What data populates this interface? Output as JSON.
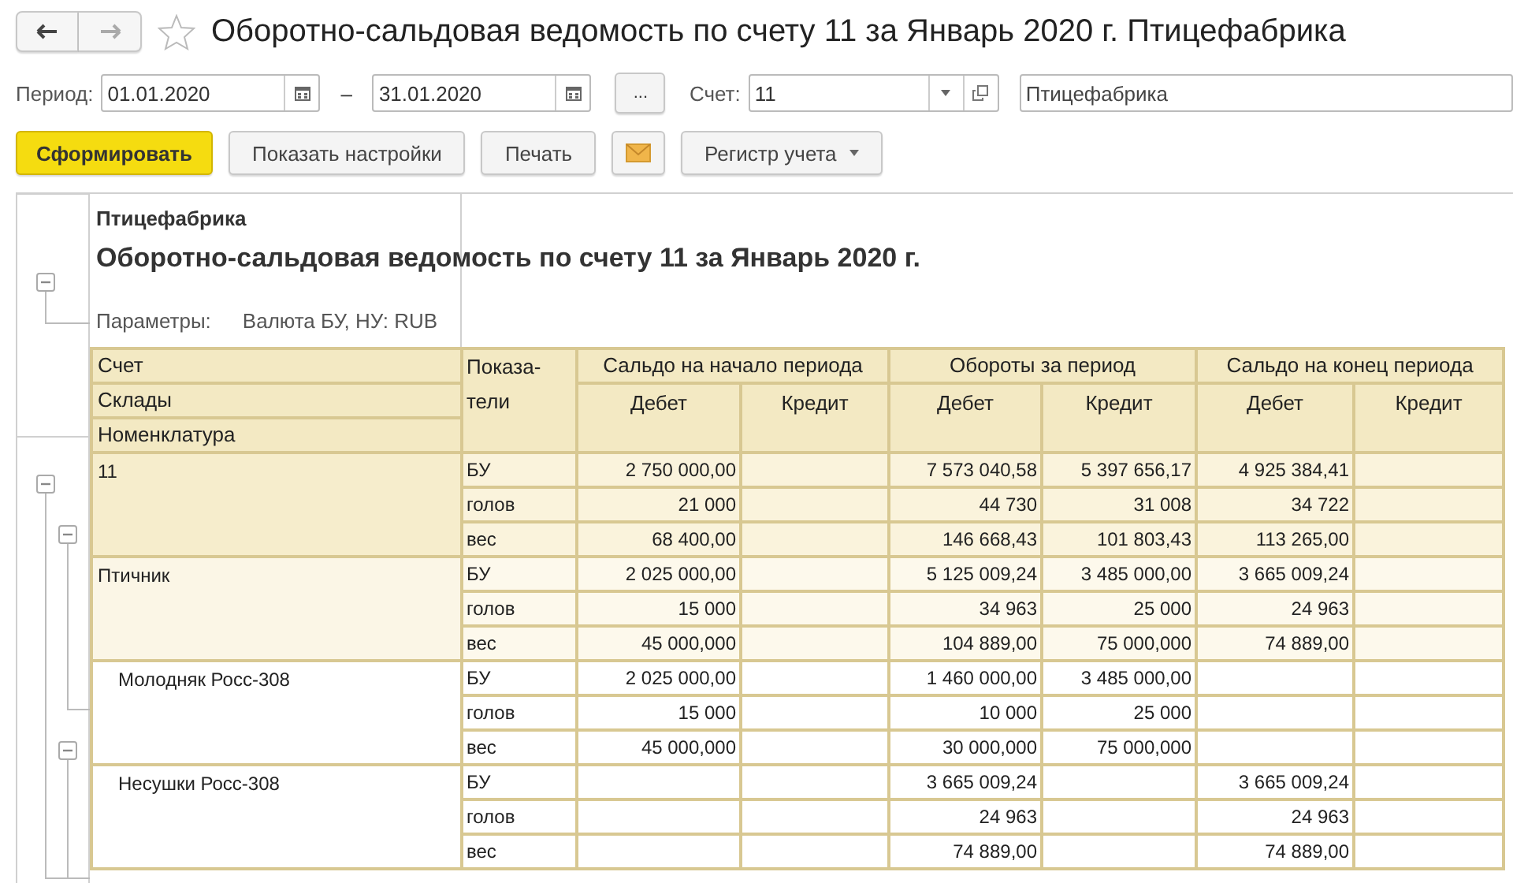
{
  "window": {
    "title": "Оборотно-сальдовая ведомость по счету 11 за Январь 2020 г. Птицефабрика"
  },
  "filters": {
    "period_label": "Период:",
    "date_from": "01.01.2020",
    "dash": "–",
    "date_to": "31.01.2020",
    "period_button": "...",
    "account_label": "Счет:",
    "account": "11",
    "organization": "Птицефабрика"
  },
  "toolbar": [
    {
      "kind": "primary",
      "label": "Сформировать"
    },
    {
      "kind": "plain",
      "label": "Показать настройки"
    },
    {
      "kind": "plain",
      "label": "Печать"
    },
    {
      "kind": "mail"
    },
    {
      "kind": "dropdown",
      "label": "Регистр учета"
    }
  ],
  "outline_toggles": [
    {
      "expanded": true
    },
    {
      "expanded": true
    },
    {
      "expanded": true
    },
    {
      "expanded": true
    }
  ],
  "report": {
    "organization": "Птицефабрика",
    "title": "Оборотно-сальдовая ведомость по счету 11 за Январь 2020 г.",
    "params_label": "Параметры:",
    "params_value": "Валюта БУ, НУ: RUB",
    "header": {
      "levels": [
        "Счет",
        "Склады",
        "Номенклатура"
      ],
      "indicators": "Показа-\nтели",
      "groups": [
        {
          "title": "Сальдо на начало периода",
          "debit": "Дебет",
          "credit": "Кредит"
        },
        {
          "title": "Обороты за период",
          "debit": "Дебет",
          "credit": "Кредит"
        },
        {
          "title": "Сальдо на конец периода",
          "debit": "Дебет",
          "credit": "Кредит"
        }
      ]
    },
    "groups": [
      {
        "name": "11",
        "rows": [
          {
            "indicator": "БУ",
            "cells": {
              "opening_debit": "2 750 000,00",
              "turnover_debit": "7 573 040,58",
              "turnover_credit": "5 397 656,17",
              "closing_debit": "4 925 384,41"
            }
          },
          {
            "indicator": "голов",
            "cells": {
              "opening_debit": "21 000",
              "turnover_debit": "44 730",
              "turnover_credit": "31 008",
              "closing_debit": "34 722"
            }
          },
          {
            "indicator": "вес",
            "cells": {
              "opening_debit": "68 400,00",
              "turnover_debit": "146 668,43",
              "turnover_credit": "101 803,43",
              "closing_debit": "113 265,00"
            }
          }
        ],
        "children": [
          {
            "name": "Птичник",
            "rows": [
              {
                "indicator": "БУ",
                "cells": {
                  "opening_debit": "2 025 000,00",
                  "turnover_debit": "5 125 009,24",
                  "turnover_credit": "3 485 000,00",
                  "closing_debit": "3 665 009,24"
                }
              },
              {
                "indicator": "голов",
                "cells": {
                  "opening_debit": "15 000",
                  "turnover_debit": "34 963",
                  "turnover_credit": "25 000",
                  "closing_debit": "24 963"
                }
              },
              {
                "indicator": "вес",
                "cells": {
                  "opening_debit": "45 000,000",
                  "turnover_debit": "104 889,00",
                  "turnover_credit": "75 000,000",
                  "closing_debit": "74 889,00"
                }
              }
            ],
            "children": [
              {
                "name": "Молодняк Росс-308",
                "rows": [
                  {
                    "indicator": "БУ",
                    "cells": {
                      "opening_debit": "2 025 000,00",
                      "turnover_debit": "1 460 000,00",
                      "turnover_credit": "3 485 000,00"
                    }
                  },
                  {
                    "indicator": "голов",
                    "cells": {
                      "opening_debit": "15 000",
                      "turnover_debit": "10 000",
                      "turnover_credit": "25 000"
                    }
                  },
                  {
                    "indicator": "вес",
                    "cells": {
                      "opening_debit": "45 000,000",
                      "turnover_debit": "30 000,000",
                      "turnover_credit": "75 000,000"
                    }
                  }
                ]
              },
              {
                "name": "Несушки Росс-308",
                "rows": [
                  {
                    "indicator": "БУ",
                    "cells": {
                      "turnover_debit": "3 665 009,24",
                      "closing_debit": "3 665 009,24"
                    }
                  },
                  {
                    "indicator": "голов",
                    "cells": {
                      "turnover_debit": "24 963",
                      "closing_debit": "24 963"
                    }
                  },
                  {
                    "indicator": "вес",
                    "cells": {
                      "turnover_debit": "74 889,00",
                      "closing_debit": "74 889,00"
                    }
                  }
                ]
              }
            ]
          }
        ]
      }
    ]
  }
}
